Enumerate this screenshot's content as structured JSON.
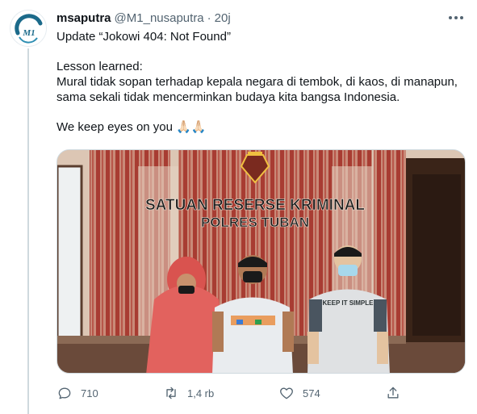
{
  "tweet": {
    "display_name": "msaputra",
    "handle": "@M1_nusaputra",
    "separator": "·",
    "time": "20j",
    "avatar_text": "M1",
    "lines": [
      "Update “Jokowi 404: Not Found”",
      "Lesson learned:",
      "Mural tidak sopan terhadap kepala negara di tembok, di kaos, di manapun, sama sekali tidak mencerminkan budaya kita bangsa Indonesia.",
      "We keep eyes on you 🙏🏻🙏🏻"
    ]
  },
  "media": {
    "sign_line1": "SATUAN RESERSE KRIMINAL",
    "sign_line2": "POLRES TUBAN",
    "shirt_text": "KEEP IT SIMPLE"
  },
  "actions": {
    "reply_count": "710",
    "retweet_count": "1,4 rb",
    "like_count": "574"
  },
  "colors": {
    "text": "#0f1419",
    "secondary": "#536471",
    "border": "#cfd9de",
    "avatar_ring": "#1b6a8a"
  },
  "icons": [
    "more-icon",
    "reply-icon",
    "retweet-icon",
    "like-icon",
    "share-icon"
  ]
}
